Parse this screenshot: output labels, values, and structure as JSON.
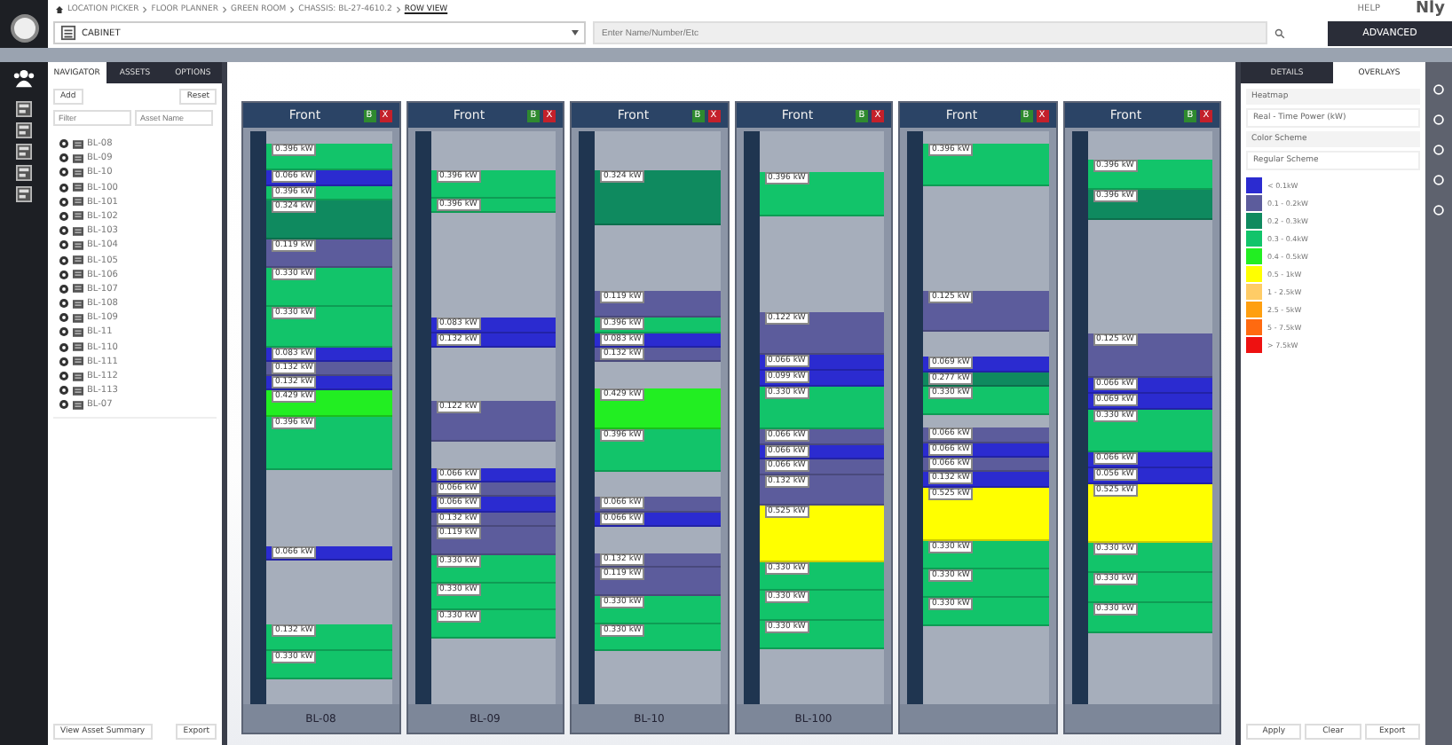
{
  "breadcrumb": [
    "LOCATION PICKER",
    "FLOOR PLANNER",
    "GREEN ROOM",
    "CHASSIS: BL-27-4610.2",
    "ROW VIEW"
  ],
  "help": "HELP",
  "brand": "Nly",
  "toolbar": {
    "type_select": "CABINET",
    "search": {
      "placeholder": "Enter Name/Number/Etc"
    },
    "advanced": "ADVANCED"
  },
  "navigator": {
    "tabs": [
      {
        "label": "NAVIGATOR",
        "selected": true
      },
      {
        "label": "ASSETS",
        "selected": false
      },
      {
        "label": "OPTIONS",
        "selected": false
      }
    ],
    "add": "Add",
    "reset": "Reset",
    "filter": {
      "placeholder": "Filter"
    },
    "name_filter": {
      "placeholder": "Asset Name"
    },
    "items": [
      "BL-08",
      "BL-09",
      "BL-10",
      "BL-100",
      "BL-101",
      "BL-102",
      "BL-103",
      "BL-104",
      "BL-105",
      "BL-106",
      "BL-107",
      "BL-108",
      "BL-109",
      "BL-11",
      "BL-110",
      "BL-111",
      "BL-112",
      "BL-113",
      "BL-07"
    ],
    "summary": "View Asset Summary",
    "export": "Export"
  },
  "racks": [
    {
      "face": "Front",
      "b": "B",
      "x": "X",
      "name": "BL-08",
      "slots": [
        {
          "kind": "empty"
        },
        {
          "kind": "device",
          "power": "0.396 kW",
          "color": "#12c46a"
        },
        {
          "kind": "device",
          "power": "0.066 kW",
          "color": "#2b2bd0"
        },
        {
          "kind": "device",
          "power": "0.396 kW",
          "color": "#12c46a"
        },
        {
          "kind": "device",
          "power": "0.324 kW",
          "color": "#0f8a5f"
        },
        {
          "kind": "device",
          "power": "0.119 kW",
          "color": "#5c5c9c"
        },
        {
          "kind": "device",
          "power": "0.330 kW",
          "color": "#12c46a"
        },
        {
          "kind": "device",
          "power": "0.330 kW",
          "color": "#12c46a"
        },
        {
          "kind": "device",
          "power": "0.083 kW",
          "color": "#2b2bd0"
        },
        {
          "kind": "device",
          "power": "0.132 kW",
          "color": "#5c5c9c"
        },
        {
          "kind": "device",
          "power": "0.132 kW",
          "color": "#2b2bd0"
        },
        {
          "kind": "device",
          "power": "0.429 kW",
          "color": "#22ee22"
        },
        {
          "kind": "device",
          "power": "0.396 kW",
          "color": "#12c46a"
        },
        {
          "kind": "empty"
        },
        {
          "kind": "device",
          "power": "0.066 kW",
          "color": "#2b2bd0"
        },
        {
          "kind": "empty"
        },
        {
          "kind": "device",
          "power": "0.132 kW",
          "color": "#12c46a"
        },
        {
          "kind": "device",
          "power": "0.330 kW",
          "color": "#12c46a"
        },
        {
          "kind": "empty"
        }
      ]
    },
    {
      "face": "Front",
      "b": "B",
      "x": "X",
      "name": "BL-09",
      "slots": [
        {
          "kind": "empty"
        },
        {
          "kind": "device",
          "power": "0.396 kW",
          "color": "#12c46a"
        },
        {
          "kind": "device",
          "power": "0.396 kW",
          "color": "#12c46a"
        },
        {
          "kind": "empty"
        },
        {
          "kind": "device",
          "power": "0.083 kW",
          "color": "#2b2bd0"
        },
        {
          "kind": "device",
          "power": "0.132 kW",
          "color": "#2b2bd0"
        },
        {
          "kind": "empty"
        },
        {
          "kind": "device",
          "power": "0.122 kW",
          "color": "#5c5c9c"
        },
        {
          "kind": "empty"
        },
        {
          "kind": "device",
          "power": "0.066 kW",
          "color": "#2b2bd0"
        },
        {
          "kind": "device",
          "power": "0.066 kW",
          "color": "#5c5c9c"
        },
        {
          "kind": "device",
          "power": "0.066 kW",
          "color": "#2b2bd0"
        },
        {
          "kind": "device",
          "power": "0.132 kW",
          "color": "#5c5c9c"
        },
        {
          "kind": "device",
          "power": "0.119 kW",
          "color": "#5c5c9c"
        },
        {
          "kind": "device",
          "power": "0.330 kW",
          "color": "#12c46a"
        },
        {
          "kind": "device",
          "power": "0.330 kW",
          "color": "#12c46a"
        },
        {
          "kind": "device",
          "power": "0.330 kW",
          "color": "#12c46a"
        },
        {
          "kind": "empty"
        }
      ]
    },
    {
      "face": "Front",
      "b": "B",
      "x": "X",
      "name": "BL-10",
      "slots": [
        {
          "kind": "empty"
        },
        {
          "kind": "device",
          "power": "0.324 kW",
          "color": "#0f8a5f"
        },
        {
          "kind": "empty"
        },
        {
          "kind": "device",
          "power": "0.119 kW",
          "color": "#5c5c9c"
        },
        {
          "kind": "device",
          "power": "0.396 kW",
          "color": "#12c46a"
        },
        {
          "kind": "device",
          "power": "0.083 kW",
          "color": "#2b2bd0"
        },
        {
          "kind": "device",
          "power": "0.132 kW",
          "color": "#5c5c9c"
        },
        {
          "kind": "empty"
        },
        {
          "kind": "device",
          "power": "0.429 kW",
          "color": "#22ee22"
        },
        {
          "kind": "device",
          "power": "0.396 kW",
          "color": "#12c46a"
        },
        {
          "kind": "empty"
        },
        {
          "kind": "device",
          "power": "0.066 kW",
          "color": "#5c5c9c"
        },
        {
          "kind": "device",
          "power": "0.066 kW",
          "color": "#2b2bd0"
        },
        {
          "kind": "empty"
        },
        {
          "kind": "device",
          "power": "0.132 kW",
          "color": "#5c5c9c"
        },
        {
          "kind": "device",
          "power": "0.119 kW",
          "color": "#5c5c9c"
        },
        {
          "kind": "device",
          "power": "0.330 kW",
          "color": "#12c46a"
        },
        {
          "kind": "device",
          "power": "0.330 kW",
          "color": "#12c46a"
        },
        {
          "kind": "empty"
        }
      ]
    },
    {
      "face": "Front",
      "b": "B",
      "x": "X",
      "name": "BL-100",
      "slots": [
        {
          "kind": "empty"
        },
        {
          "kind": "device",
          "power": "0.396 kW",
          "color": "#12c46a"
        },
        {
          "kind": "empty"
        },
        {
          "kind": "device",
          "power": "0.122 kW",
          "color": "#5c5c9c"
        },
        {
          "kind": "device",
          "power": "0.066 kW",
          "color": "#2b2bd0"
        },
        {
          "kind": "device",
          "power": "0.099 kW",
          "color": "#2b2bd0"
        },
        {
          "kind": "device",
          "power": "0.330 kW",
          "color": "#12c46a"
        },
        {
          "kind": "device",
          "power": "0.066 kW",
          "color": "#5c5c9c"
        },
        {
          "kind": "device",
          "power": "0.066 kW",
          "color": "#2b2bd0"
        },
        {
          "kind": "device",
          "power": "0.066 kW",
          "color": "#5c5c9c"
        },
        {
          "kind": "device",
          "power": "0.132 kW",
          "color": "#5c5c9c"
        },
        {
          "kind": "device",
          "power": "0.525 kW",
          "color": "#ffff00"
        },
        {
          "kind": "device",
          "power": "0.330 kW",
          "color": "#12c46a"
        },
        {
          "kind": "device",
          "power": "0.330 kW",
          "color": "#12c46a"
        },
        {
          "kind": "device",
          "power": "0.330 kW",
          "color": "#12c46a"
        },
        {
          "kind": "empty"
        }
      ]
    },
    {
      "face": "Front",
      "b": "B",
      "x": "X",
      "slots": [
        {
          "kind": "empty"
        },
        {
          "kind": "device",
          "power": "0.396 kW",
          "color": "#12c46a"
        },
        {
          "kind": "empty"
        },
        {
          "kind": "device",
          "power": "0.125 kW",
          "color": "#5c5c9c"
        },
        {
          "kind": "empty"
        },
        {
          "kind": "device",
          "power": "0.069 kW",
          "color": "#2b2bd0"
        },
        {
          "kind": "device",
          "power": "0.277 kW",
          "color": "#0f8a5f"
        },
        {
          "kind": "device",
          "power": "0.330 kW",
          "color": "#12c46a"
        },
        {
          "kind": "empty"
        },
        {
          "kind": "device",
          "power": "0.066 kW",
          "color": "#5c5c9c"
        },
        {
          "kind": "device",
          "power": "0.066 kW",
          "color": "#2b2bd0"
        },
        {
          "kind": "device",
          "power": "0.066 kW",
          "color": "#5c5c9c"
        },
        {
          "kind": "device",
          "power": "0.132 kW",
          "color": "#2b2bd0"
        },
        {
          "kind": "device",
          "power": "0.525 kW",
          "color": "#ffff00"
        },
        {
          "kind": "device",
          "power": "0.330 kW",
          "color": "#12c46a"
        },
        {
          "kind": "device",
          "power": "0.330 kW",
          "color": "#12c46a"
        },
        {
          "kind": "device",
          "power": "0.330 kW",
          "color": "#12c46a"
        },
        {
          "kind": "empty"
        }
      ]
    },
    {
      "face": "Front",
      "b": "B",
      "x": "X",
      "slots": [
        {
          "kind": "empty"
        },
        {
          "kind": "device",
          "power": "0.396 kW",
          "color": "#12c46a"
        },
        {
          "kind": "device",
          "power": "0.396 kW",
          "color": "#0f8a5f"
        },
        {
          "kind": "empty"
        },
        {
          "kind": "device",
          "power": "0.125 kW",
          "color": "#5c5c9c"
        },
        {
          "kind": "device",
          "power": "0.066 kW",
          "color": "#2b2bd0"
        },
        {
          "kind": "device",
          "power": "0.069 kW",
          "color": "#2b2bd0"
        },
        {
          "kind": "device",
          "power": "0.330 kW",
          "color": "#12c46a"
        },
        {
          "kind": "device",
          "power": "0.066 kW",
          "color": "#2b2bd0"
        },
        {
          "kind": "device",
          "power": "0.056 kW",
          "color": "#2b2bd0"
        },
        {
          "kind": "device",
          "power": "0.525 kW",
          "color": "#ffff00"
        },
        {
          "kind": "device",
          "power": "0.330 kW",
          "color": "#12c46a"
        },
        {
          "kind": "device",
          "power": "0.330 kW",
          "color": "#12c46a"
        },
        {
          "kind": "device",
          "power": "0.330 kW",
          "color": "#12c46a"
        },
        {
          "kind": "empty"
        }
      ]
    }
  ],
  "overlays": {
    "tabs": [
      {
        "label": "DETAILS",
        "selected": false
      },
      {
        "label": "OVERLAYS",
        "selected": true
      }
    ],
    "heatmap_label": "Heatmap",
    "heatmap": "Real - Time Power (kW)",
    "scheme_label": "Color Scheme",
    "scheme": "Regular Scheme",
    "legend": [
      {
        "label": "< 0.1kW",
        "color": "#2b2bd0"
      },
      {
        "label": "0.1 - 0.2kW",
        "color": "#5c5c9c"
      },
      {
        "label": "0.2 - 0.3kW",
        "color": "#0f8a5f"
      },
      {
        "label": "0.3 - 0.4kW",
        "color": "#12c46a"
      },
      {
        "label": "0.4 - 0.5kW",
        "color": "#22ee22"
      },
      {
        "label": "0.5 - 1kW",
        "color": "#ffff00"
      },
      {
        "label": "1 - 2.5kW",
        "color": "#ffcc66"
      },
      {
        "label": "2.5 - 5kW",
        "color": "#ff9f10"
      },
      {
        "label": "5 - 7.5kW",
        "color": "#ff6a10"
      },
      {
        "label": "> 7.5kW",
        "color": "#ee1111"
      }
    ],
    "apply": "Apply",
    "clear": "Clear",
    "export": "Export"
  }
}
